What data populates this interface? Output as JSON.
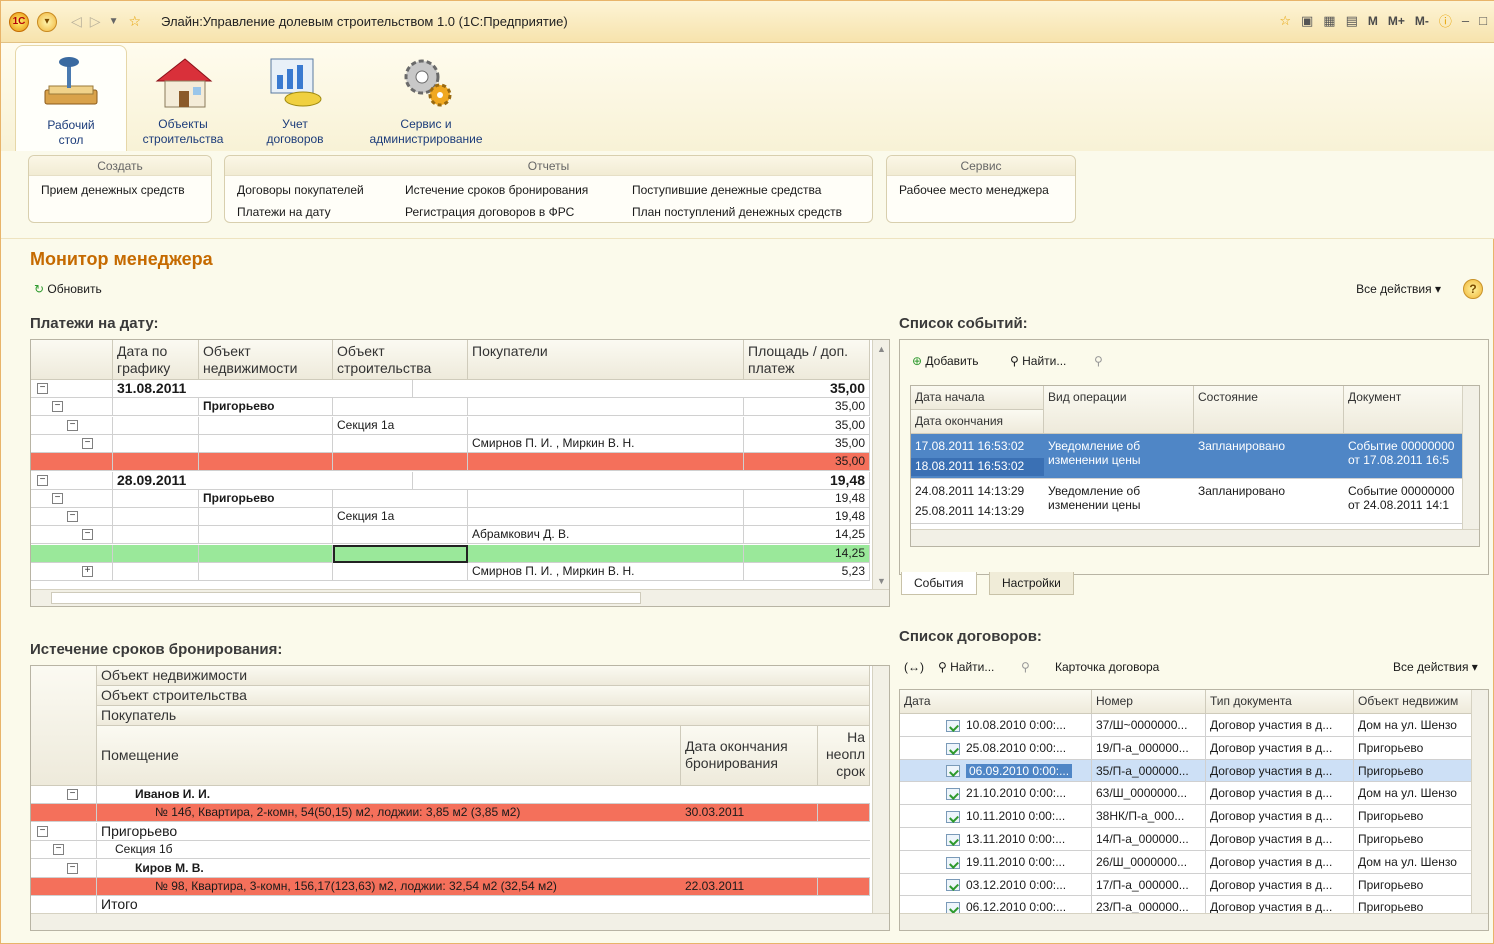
{
  "window": {
    "title": "Элайн:Управление долевым строительством 1.0  (1С:Предприятие)",
    "right_buttons": [
      "M",
      "M+",
      "M-"
    ]
  },
  "sections": [
    {
      "label1": "Рабочий",
      "label2": "стол",
      "icon": "desktop-icon"
    },
    {
      "label1": "Объекты",
      "label2": "строительства",
      "icon": "house-icon"
    },
    {
      "label1": "Учет",
      "label2": "договоров",
      "icon": "contracts-icon"
    },
    {
      "label1": "Сервис и",
      "label2": "администрирование",
      "icon": "gears-icon"
    }
  ],
  "groups": {
    "create": {
      "title": "Создать",
      "items": [
        "Прием денежных средств"
      ]
    },
    "reports": {
      "title": "Отчеты",
      "items": [
        "Договоры покупателей",
        "Платежи на дату",
        "Истечение сроков бронирования",
        "Регистрация договоров в ФРС",
        "Поступившие денежные средства",
        "План поступлений денежных средств"
      ]
    },
    "service": {
      "title": "Сервис",
      "items": [
        "Рабочее место менеджера"
      ]
    }
  },
  "page": {
    "title": "Монитор менеджера",
    "refresh": "Обновить",
    "all_actions": "Все действия",
    "help": "?"
  },
  "payments": {
    "title": "Платежи на дату:",
    "headers": [
      "Дата по графику",
      "Объект недвижимости",
      "Объект строительства",
      "Покупатели",
      "Площадь / доп. платеж"
    ],
    "rows": [
      {
        "date": "31.08.2011",
        "obj": "",
        "build": "",
        "buyer": "",
        "area": "35,00",
        "kind": "date"
      },
      {
        "date": "",
        "obj": "Пригорьево",
        "build": "",
        "buyer": "",
        "area": "35,00",
        "kind": "obj"
      },
      {
        "date": "",
        "obj": "",
        "build": "Секция 1а",
        "buyer": "",
        "area": "35,00",
        "kind": "build"
      },
      {
        "date": "",
        "obj": "",
        "build": "",
        "buyer": "Смирнов П. И. , Миркин В. Н.",
        "area": "35,00",
        "kind": "buyer"
      },
      {
        "date": "",
        "obj": "",
        "build": "",
        "buyer": "",
        "area": "35,00",
        "kind": "red"
      },
      {
        "date": "28.09.2011",
        "obj": "",
        "build": "",
        "buyer": "",
        "area": "19,48",
        "kind": "date"
      },
      {
        "date": "",
        "obj": "Пригорьево",
        "build": "",
        "buyer": "",
        "area": "19,48",
        "kind": "obj"
      },
      {
        "date": "",
        "obj": "",
        "build": "Секция 1а",
        "buyer": "",
        "area": "19,48",
        "kind": "build"
      },
      {
        "date": "",
        "obj": "",
        "build": "",
        "buyer": "Абрамкович Д. В.",
        "area": "14,25",
        "kind": "buyer"
      },
      {
        "date": "",
        "obj": "",
        "build": "",
        "buyer": "",
        "area": "14,25",
        "kind": "green"
      },
      {
        "date": "",
        "obj": "",
        "build": "",
        "buyer": "Смирнов П. И. , Миркин В. Н.",
        "area": "5,23",
        "kind": "buyer2"
      }
    ]
  },
  "events": {
    "title": "Список событий:",
    "add": "Добавить",
    "find": "Найти...",
    "headers": [
      "Дата начала",
      "Дата окончания",
      "Вид операции",
      "Состояние",
      "Документ"
    ],
    "rows": [
      {
        "start": "17.08.2011 16:53:02",
        "end": "18.08.2011 16:53:02",
        "op1": "Уведомление об",
        "op2": "изменении цены",
        "state": "Запланировано",
        "doc1": "Событие 00000000",
        "doc2": "от 17.08.2011 16:5"
      },
      {
        "start": "24.08.2011 14:13:29",
        "end": "25.08.2011 14:13:29",
        "op1": "Уведомление об",
        "op2": "изменении цены",
        "state": "Запланировано",
        "doc1": "Событие 00000000",
        "doc2": "от 24.08.2011 14:1"
      }
    ],
    "tabs": [
      "События",
      "Настройки"
    ]
  },
  "reservations": {
    "title": "Истечение сроков бронирования:",
    "headers": [
      "Объект недвижимости",
      "Объект строительства",
      "Покупатель",
      "Помещение",
      "Дата окончания бронирования",
      "На неопл срок"
    ],
    "rows": [
      {
        "text": "Иванов И. И.",
        "date": "",
        "kind": "buyer"
      },
      {
        "text": "№ 14б, Квартира, 2-комн, 54(50,15)  м2, лоджии: 3,85 м2  (3,85 м2)",
        "date": "30.03.2011",
        "kind": "red"
      },
      {
        "text": "Пригорьево",
        "date": "",
        "kind": "obj"
      },
      {
        "text": "Секция 1б",
        "date": "",
        "kind": "build"
      },
      {
        "text": "Киров М. В.",
        "date": "",
        "kind": "buyer"
      },
      {
        "text": "№ 98, Квартира, 3-комн, 156,17(123,63)  м2, лоджии: 32,54 м2  (32,54 м2)",
        "date": "22.03.2011",
        "kind": "red"
      },
      {
        "text": "Итого",
        "date": "",
        "kind": "total"
      }
    ]
  },
  "contracts": {
    "title": "Список договоров:",
    "find": "Найти...",
    "card": "Карточка договора",
    "all_actions": "Все действия",
    "headers": [
      "Дата",
      "Номер",
      "Тип документа",
      "Объект недвижим"
    ],
    "rows": [
      {
        "date": "10.08.2010 0:00:...",
        "num": "37/Ш~0000000...",
        "type": "Договор участия в д...",
        "obj": "Дом на ул. Шензо"
      },
      {
        "date": "25.08.2010 0:00:...",
        "num": "19/П-а_000000...",
        "type": "Договор участия в д...",
        "obj": "Пригорьево"
      },
      {
        "date": "06.09.2010 0:00:...",
        "num": "35/П-а_000000...",
        "type": "Договор участия в д...",
        "obj": "Пригорьево"
      },
      {
        "date": "21.10.2010 0:00:...",
        "num": "63/Ш_0000000...",
        "type": "Договор участия в д...",
        "obj": "Дом на ул. Шензо"
      },
      {
        "date": "10.11.2010 0:00:...",
        "num": "38НК/П-а_000...",
        "type": "Договор участия в д...",
        "obj": "Пригорьево"
      },
      {
        "date": "13.11.2010 0:00:...",
        "num": "14/П-а_000000...",
        "type": "Договор участия в д...",
        "obj": "Пригорьево"
      },
      {
        "date": "19.11.2010 0:00:...",
        "num": "26/Ш_0000000...",
        "type": "Договор участия в д...",
        "obj": "Дом на ул. Шензо"
      },
      {
        "date": "03.12.2010 0:00:...",
        "num": "17/П-а_000000...",
        "type": "Договор участия в д...",
        "obj": "Пригорьево"
      },
      {
        "date": "06.12.2010 0:00:...",
        "num": "23/П-а_000000...",
        "type": "Договор участия в д...",
        "obj": "Пригорьево"
      }
    ]
  },
  "colors": {
    "accent": "#c56a00",
    "red_row": "#f4705b",
    "green_row": "#9ae89a",
    "selection": "#4f86c6"
  }
}
